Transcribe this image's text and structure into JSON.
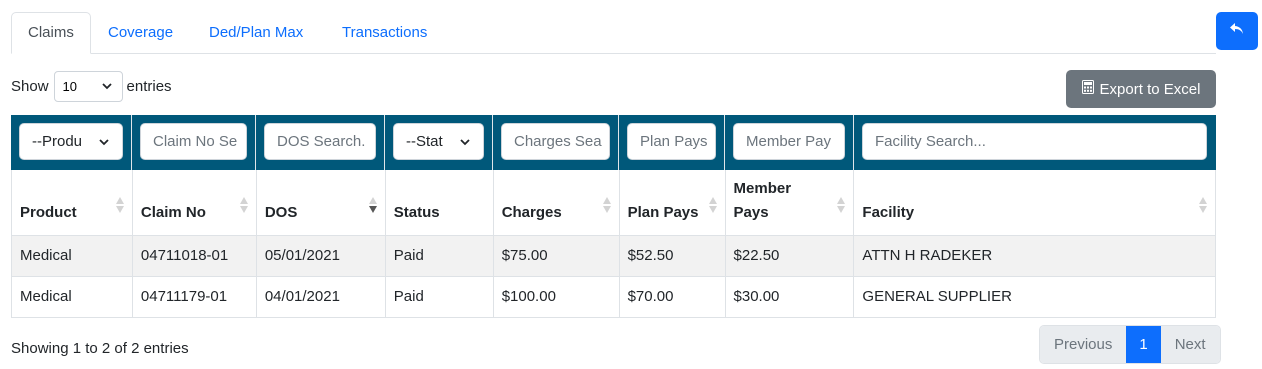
{
  "tabs": [
    {
      "label": "Claims",
      "active": true
    },
    {
      "label": "Coverage"
    },
    {
      "label": "Ded/Plan Max"
    },
    {
      "label": "Transactions"
    }
  ],
  "length": {
    "prefix": "Show",
    "value": "10",
    "suffix": "entries"
  },
  "export": {
    "label": "Export to Excel"
  },
  "filters": {
    "product": "--Produ",
    "claim_no": "Claim No Se",
    "dos": "DOS Search.",
    "status": "--Stat",
    "charges": "Charges Sea",
    "plan_pays": "Plan Pays",
    "member_pays": "Member Pay",
    "facility": "Facility Search..."
  },
  "columns": {
    "product": "Product",
    "claim_no": "Claim No",
    "dos": "DOS",
    "status": "Status",
    "charges": "Charges",
    "plan_pays": "Plan Pays",
    "member_pays_1": "Member",
    "member_pays_2": "Pays",
    "facility": "Facility"
  },
  "rows": [
    {
      "product": "Medical",
      "claim_no": "04711018-01",
      "dos": "05/01/2021",
      "status": "Paid",
      "charges": "$75.00",
      "plan_pays": "$52.50",
      "member_pays": "$22.50",
      "facility": "ATTN H RADEKER"
    },
    {
      "product": "Medical",
      "claim_no": "04711179-01",
      "dos": "04/01/2021",
      "status": "Paid",
      "charges": "$100.00",
      "plan_pays": "$70.00",
      "member_pays": "$30.00",
      "facility": "GENERAL SUPPLIER"
    }
  ],
  "info": "Showing 1 to 2 of 2 entries",
  "pagination": {
    "previous": "Previous",
    "current": "1",
    "next": "Next"
  },
  "colors": {
    "accent": "#0d6efd",
    "filterbar": "#00587a",
    "secondary": "#6c757d"
  },
  "icons": {
    "back": "reply-icon",
    "export": "table-calc-icon"
  }
}
